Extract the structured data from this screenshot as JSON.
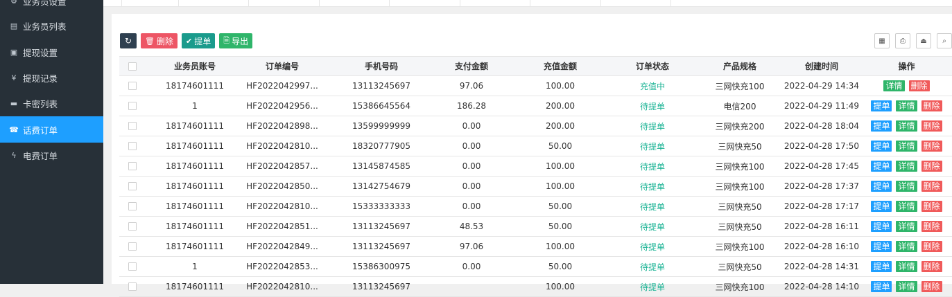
{
  "sidebar": {
    "items": [
      {
        "label": "业务员设置",
        "icon": "gear-icon"
      },
      {
        "label": "业务员列表",
        "icon": "id-card-icon"
      },
      {
        "label": "提现设置",
        "icon": "money-icon"
      },
      {
        "label": "提现记录",
        "icon": "yen-icon"
      },
      {
        "label": "卡密列表",
        "icon": "credit-card-icon"
      },
      {
        "label": "话费订单",
        "icon": "phone-icon",
        "active": true
      },
      {
        "label": "电费订单",
        "icon": "bolt-icon"
      }
    ]
  },
  "toolbar": {
    "refresh_icon": "refresh-icon",
    "delete_label": "删除",
    "submit_label": "提单",
    "export_label": "导出"
  },
  "right_tools": [
    "columns-icon",
    "print-icon",
    "export-icon",
    "search-icon"
  ],
  "table": {
    "columns": [
      "业务员账号",
      "订单编号",
      "手机号码",
      "支付金额",
      "充值金额",
      "订单状态",
      "产品规格",
      "创建时间",
      "操作"
    ],
    "action_labels": {
      "submit": "提单",
      "detail": "详情",
      "delete": "删除"
    },
    "rows": [
      {
        "account": "18174601111",
        "order_no": "HF2022042997...",
        "phone": "13113245697",
        "pay": "97.06",
        "recharge": "100.00",
        "status": "充值中",
        "spec": "三网快充100",
        "created": "2022-04-29 14:34",
        "can_submit": false
      },
      {
        "account": "1",
        "order_no": "HF2022042956...",
        "phone": "15386645564",
        "pay": "186.28",
        "recharge": "200.00",
        "status": "待提单",
        "spec": "电信200",
        "created": "2022-04-29 11:49",
        "can_submit": true
      },
      {
        "account": "18174601111",
        "order_no": "HF2022042898...",
        "phone": "13599999999",
        "pay": "0.00",
        "recharge": "200.00",
        "status": "待提单",
        "spec": "三网快充200",
        "created": "2022-04-28 18:04",
        "can_submit": true
      },
      {
        "account": "18174601111",
        "order_no": "HF2022042810...",
        "phone": "18320777905",
        "pay": "0.00",
        "recharge": "50.00",
        "status": "待提单",
        "spec": "三网快充50",
        "created": "2022-04-28 17:50",
        "can_submit": true
      },
      {
        "account": "18174601111",
        "order_no": "HF2022042857...",
        "phone": "13145874585",
        "pay": "0.00",
        "recharge": "100.00",
        "status": "待提单",
        "spec": "三网快充100",
        "created": "2022-04-28 17:45",
        "can_submit": true
      },
      {
        "account": "18174601111",
        "order_no": "HF2022042850...",
        "phone": "13142754679",
        "pay": "0.00",
        "recharge": "100.00",
        "status": "待提单",
        "spec": "三网快充100",
        "created": "2022-04-28 17:37",
        "can_submit": true
      },
      {
        "account": "18174601111",
        "order_no": "HF2022042810...",
        "phone": "15333333333",
        "pay": "0.00",
        "recharge": "50.00",
        "status": "待提单",
        "spec": "三网快充50",
        "created": "2022-04-28 17:17",
        "can_submit": true
      },
      {
        "account": "18174601111",
        "order_no": "HF2022042851...",
        "phone": "13113245697",
        "pay": "48.53",
        "recharge": "50.00",
        "status": "待提单",
        "spec": "三网快充50",
        "created": "2022-04-28 16:11",
        "can_submit": true
      },
      {
        "account": "18174601111",
        "order_no": "HF2022042849...",
        "phone": "13113245697",
        "pay": "97.06",
        "recharge": "100.00",
        "status": "待提单",
        "spec": "三网快充100",
        "created": "2022-04-28 16:10",
        "can_submit": true
      },
      {
        "account": "1",
        "order_no": "HF2022042853...",
        "phone": "15386300975",
        "pay": "0.00",
        "recharge": "50.00",
        "status": "待提单",
        "spec": "三网快充50",
        "created": "2022-04-28 14:31",
        "can_submit": true
      },
      {
        "account": "18174601111",
        "order_no": "HF2022042810...",
        "phone": "13113245697",
        "pay": "",
        "recharge": "100.00",
        "status": "待提单",
        "spec": "三网快充100",
        "created": "2022-04-28 14:10",
        "can_submit": true
      }
    ]
  }
}
